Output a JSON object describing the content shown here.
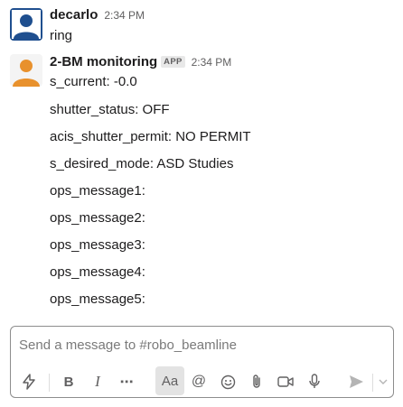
{
  "messages": [
    {
      "sender": "decarlo",
      "time": "2:34 PM",
      "avatar": "default-user-avatar",
      "lines": [
        "ring"
      ]
    },
    {
      "sender": "2-BM monitoring",
      "badge": "APP",
      "time": "2:34 PM",
      "avatar": "app-person-avatar",
      "lines": [
        "s_current: -0.0",
        "shutter_status: OFF",
        "acis_shutter_permit: NO PERMIT",
        "s_desired_mode: ASD Studies",
        "ops_message1:",
        "ops_message2:",
        "ops_message3:",
        "ops_message4:",
        "ops_message5:"
      ]
    }
  ],
  "composer": {
    "placeholder": "Send a message to #robo_beamline",
    "toolbar": {
      "shortcuts": "lightning-icon",
      "bold": "B",
      "italic": "I",
      "more": "⋯",
      "format": "Aa",
      "mention": "@",
      "emoji": "smiley-icon",
      "attach": "paperclip-icon",
      "video": "video-icon",
      "audio": "microphone-icon",
      "send": "send-icon",
      "send_options": "chevron-down-icon"
    }
  },
  "colors": {
    "text": "#1d1c1d",
    "muted": "#616061",
    "avatar_blue": "#1f4f8f",
    "avatar_orange": "#e8912d",
    "border": "#8d8d8d"
  }
}
